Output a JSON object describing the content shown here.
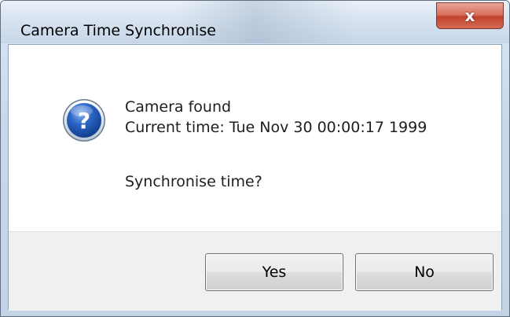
{
  "window": {
    "title": "Camera Time Synchronise",
    "close_glyph": "x"
  },
  "message": {
    "icon": "question-icon",
    "line1": "Camera found",
    "line2": "Current time: Tue Nov 30 00:00:17 1999",
    "question": "Synchronise time?"
  },
  "buttons": {
    "yes_label": "Yes",
    "no_label": "No"
  },
  "colors": {
    "titlebar": "#d6e2f0",
    "close_button": "#c2432e",
    "icon_blue": "#1f57b8",
    "button_area": "#f0f0f0"
  }
}
